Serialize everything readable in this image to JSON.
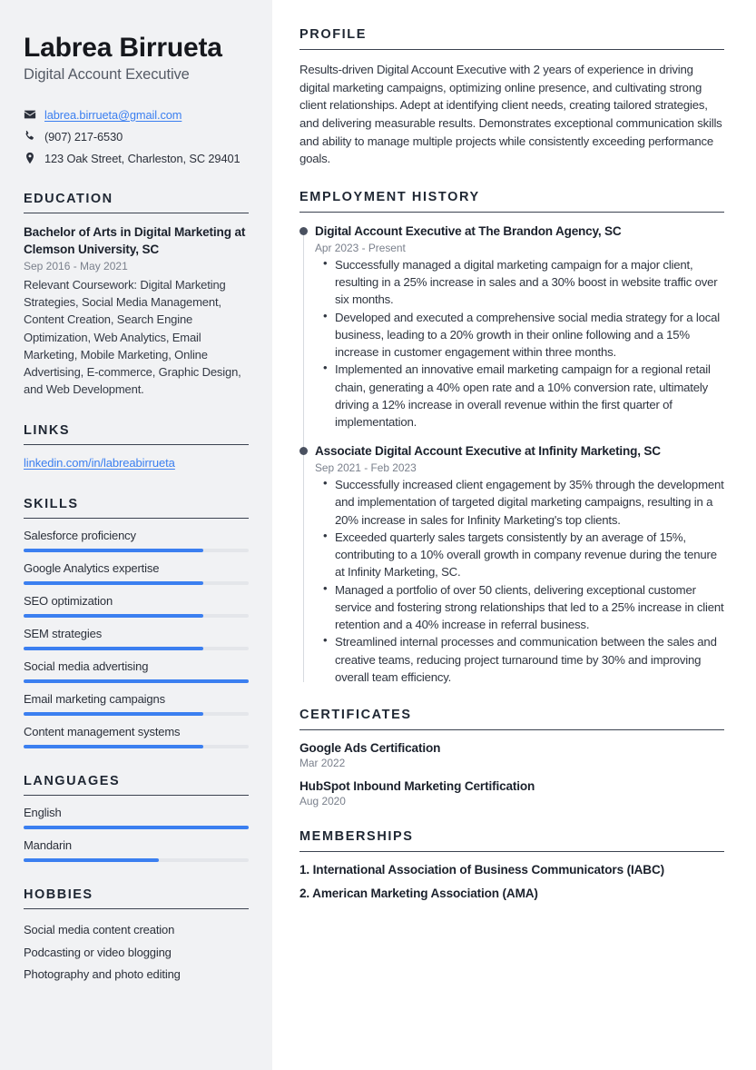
{
  "theme": {
    "sidebar_bg": "#f1f2f4",
    "accent": "#3b7ff0",
    "heading": "#1f2733",
    "muted": "#7a808c"
  },
  "header": {
    "name": "Labrea Birrueta",
    "job_title": "Digital Account Executive"
  },
  "contact": [
    {
      "icon": "envelope-icon",
      "text": "labrea.birrueta@gmail.com",
      "is_link": true
    },
    {
      "icon": "phone-icon",
      "text": "(907) 217-6530",
      "is_link": false
    },
    {
      "icon": "location-pin-icon",
      "text": "123 Oak Street, Charleston, SC 29401",
      "is_link": false
    }
  ],
  "sidebar": {
    "education": {
      "heading": "EDUCATION",
      "entries": [
        {
          "title": "Bachelor of Arts in Digital Marketing at Clemson University, SC",
          "date": "Sep 2016 - May 2021",
          "description": "Relevant Coursework: Digital Marketing Strategies, Social Media Management, Content Creation, Search Engine Optimization, Web Analytics, Email Marketing, Mobile Marketing, Online Advertising, E-commerce, Graphic Design, and Web Development."
        }
      ]
    },
    "links": {
      "heading": "LINKS",
      "items": [
        {
          "label": "linkedin.com/in/labreabirrueta"
        }
      ]
    },
    "skills": {
      "heading": "SKILLS",
      "items": [
        {
          "label": "Salesforce proficiency",
          "level": 80
        },
        {
          "label": "Google Analytics expertise",
          "level": 80
        },
        {
          "label": "SEO optimization",
          "level": 80
        },
        {
          "label": "SEM strategies",
          "level": 80
        },
        {
          "label": "Social media advertising",
          "level": 100
        },
        {
          "label": "Email marketing campaigns",
          "level": 80
        },
        {
          "label": "Content management systems",
          "level": 80
        }
      ]
    },
    "languages": {
      "heading": "LANGUAGES",
      "items": [
        {
          "label": "English",
          "level": 100
        },
        {
          "label": "Mandarin",
          "level": 60
        }
      ]
    },
    "hobbies": {
      "heading": "HOBBIES",
      "items": [
        {
          "label": "Social media content creation"
        },
        {
          "label": "Podcasting or video blogging"
        },
        {
          "label": "Photography and photo editing"
        }
      ]
    }
  },
  "main": {
    "profile": {
      "heading": "PROFILE",
      "text": "Results-driven Digital Account Executive with 2 years of experience in driving digital marketing campaigns, optimizing online presence, and cultivating strong client relationships. Adept at identifying client needs, creating tailored strategies, and delivering measurable results. Demonstrates exceptional communication skills and ability to manage multiple projects while consistently exceeding performance goals."
    },
    "employment": {
      "heading": "EMPLOYMENT HISTORY",
      "jobs": [
        {
          "title": "Digital Account Executive at The Brandon Agency, SC",
          "date": "Apr 2023 - Present",
          "bullets": [
            "Successfully managed a digital marketing campaign for a major client, resulting in a 25% increase in sales and a 30% boost in website traffic over six months.",
            "Developed and executed a comprehensive social media strategy for a local business, leading to a 20% growth in their online following and a 15% increase in customer engagement within three months.",
            "Implemented an innovative email marketing campaign for a regional retail chain, generating a 40% open rate and a 10% conversion rate, ultimately driving a 12% increase in overall revenue within the first quarter of implementation."
          ]
        },
        {
          "title": "Associate Digital Account Executive at Infinity Marketing, SC",
          "date": "Sep 2021 - Feb 2023",
          "bullets": [
            "Successfully increased client engagement by 35% through the development and implementation of targeted digital marketing campaigns, resulting in a 20% increase in sales for Infinity Marketing's top clients.",
            "Exceeded quarterly sales targets consistently by an average of 15%, contributing to a 10% overall growth in company revenue during the tenure at Infinity Marketing, SC.",
            "Managed a portfolio of over 50 clients, delivering exceptional customer service and fostering strong relationships that led to a 25% increase in client retention and a 40% increase in referral business.",
            "Streamlined internal processes and communication between the sales and creative teams, reducing project turnaround time by 30% and improving overall team efficiency."
          ]
        }
      ]
    },
    "certificates": {
      "heading": "CERTIFICATES",
      "items": [
        {
          "name": "Google Ads Certification",
          "date": "Mar 2022"
        },
        {
          "name": "HubSpot Inbound Marketing Certification",
          "date": "Aug 2020"
        }
      ]
    },
    "memberships": {
      "heading": "MEMBERSHIPS",
      "items": [
        {
          "label": "1. International Association of Business Communicators (IABC)"
        },
        {
          "label": "2. American Marketing Association (AMA)"
        }
      ]
    }
  }
}
